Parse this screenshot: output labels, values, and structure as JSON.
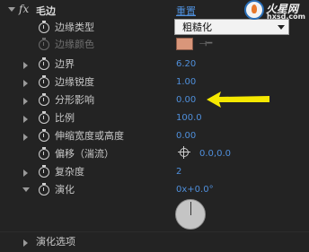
{
  "effect": {
    "fx_label": "fx",
    "title": "毛边",
    "reset_label": "重置"
  },
  "properties": {
    "edge_type": {
      "label": "边缘类型",
      "value": "粗糙化"
    },
    "edge_color": {
      "label": "边缘颜色",
      "color": "#d9967a"
    },
    "border": {
      "label": "边界",
      "value": "6.20"
    },
    "edge_sharpness": {
      "label": "边缘锐度",
      "value": "1.00"
    },
    "fractal_influence": {
      "label": "分形影响",
      "value": "0.00"
    },
    "scale": {
      "label": "比例",
      "value": "100.0"
    },
    "stretch": {
      "label": "伸缩宽度或高度",
      "value": "0.00"
    },
    "offset": {
      "label": "偏移（湍流）",
      "value": "0.0,0.0"
    },
    "complexity": {
      "label": "复杂度",
      "value": "2"
    },
    "evolution": {
      "label": "演化",
      "value": "0x+0.0°"
    },
    "evolution_options": {
      "label": "演化选项"
    }
  },
  "watermark": {
    "name": "火星网",
    "url": "hxsd.com"
  },
  "colors": {
    "value_blue": "#4f8fdb",
    "highlight_arrow": "#f5e800",
    "background": "#232323"
  },
  "icons": {
    "stopwatch": "stopwatch-icon",
    "expand": "triangle-right-icon",
    "collapse": "triangle-down-icon",
    "crosshair": "crosshair-icon",
    "eyedropper": "eyedropper-icon"
  }
}
